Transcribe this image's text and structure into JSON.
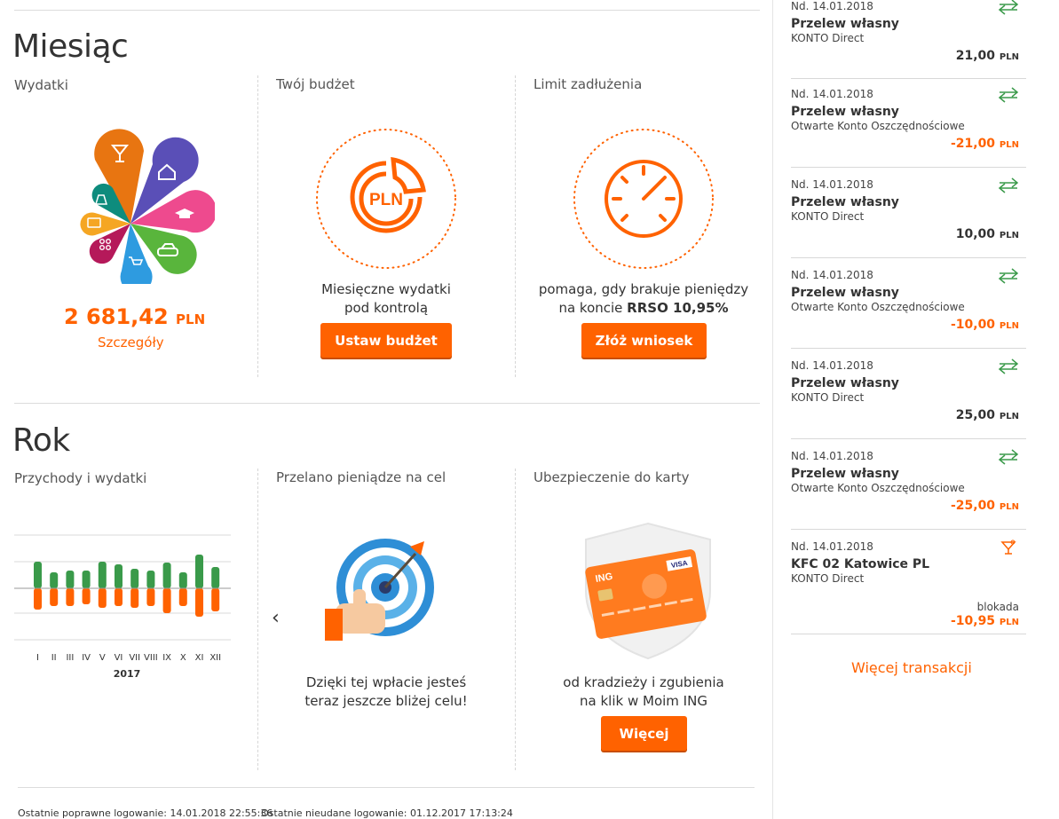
{
  "month": {
    "title": "Miesiąc",
    "expenses": {
      "label": "Wydatki",
      "amount": "2 681,42",
      "currency": "PLN",
      "link": "Szczegóły"
    },
    "budget": {
      "label": "Twój budżet",
      "icon_text": "PLN",
      "text_line1": "Miesięczne wydatki",
      "text_line2": "pod kontrolą",
      "button": "Ustaw budżet"
    },
    "debt": {
      "label": "Limit zadłużenia",
      "text_line1": "pomaga, gdy brakuje pieniędzy",
      "text_line2_prefix": "na koncie ",
      "text_line2_bold": "RRSO 10,95%",
      "button": "Złóż wniosek"
    }
  },
  "year": {
    "title": "Rok",
    "chart_label": "Przychody i wydatki",
    "goal": {
      "label": "Przelano pieniądze na cel",
      "text_line1": "Dzięki tej wpłacie jesteś",
      "text_line2": "teraz jeszcze bliżej celu!"
    },
    "insurance": {
      "label": "Ubezpieczenie do karty",
      "card_brand": "ING",
      "card_network": "VISA",
      "text_line1": "od kradzieży i zgubienia",
      "text_line2": "na klik w Moim ING",
      "button": "Więcej"
    }
  },
  "chart_data": {
    "type": "bar",
    "categories": [
      "I",
      "II",
      "III",
      "IV",
      "V",
      "VI",
      "VII",
      "VIII",
      "IX",
      "X",
      "XI",
      "XII"
    ],
    "year_label": "2017",
    "series": [
      {
        "values": [
          30,
          18,
          20,
          20,
          30,
          27,
          22,
          20,
          29,
          18,
          38,
          24
        ],
        "color": "#3a9a4a"
      },
      {
        "values": [
          -24,
          -20,
          -20,
          -18,
          -22,
          -20,
          -22,
          -20,
          -28,
          -20,
          -32,
          -26
        ],
        "color": "#ff6200"
      }
    ]
  },
  "transactions": [
    {
      "date": "Nd. 14.01.2018",
      "title": "Przelew własny",
      "account": "KONTO Direct",
      "amount": "21,00",
      "currency": "PLN",
      "negative": false,
      "icon": "transfer-icon"
    },
    {
      "date": "Nd. 14.01.2018",
      "title": "Przelew własny",
      "account": "Otwarte Konto Oszczędnościowe",
      "amount": "-21,00",
      "currency": "PLN",
      "negative": true,
      "icon": "transfer-icon"
    },
    {
      "date": "Nd. 14.01.2018",
      "title": "Przelew własny",
      "account": "KONTO Direct",
      "amount": "10,00",
      "currency": "PLN",
      "negative": false,
      "icon": "transfer-icon"
    },
    {
      "date": "Nd. 14.01.2018",
      "title": "Przelew własny",
      "account": "Otwarte Konto Oszczędnościowe",
      "amount": "-10,00",
      "currency": "PLN",
      "negative": true,
      "icon": "transfer-icon"
    },
    {
      "date": "Nd. 14.01.2018",
      "title": "Przelew własny",
      "account": "KONTO Direct",
      "amount": "25,00",
      "currency": "PLN",
      "negative": false,
      "icon": "transfer-icon"
    },
    {
      "date": "Nd. 14.01.2018",
      "title": "Przelew własny",
      "account": "Otwarte Konto Oszczędnościowe",
      "amount": "-25,00",
      "currency": "PLN",
      "negative": true,
      "icon": "transfer-icon"
    },
    {
      "date": "Nd. 14.01.2018",
      "title": "KFC 02 Katowice PL",
      "account": "KONTO Direct",
      "note": "blokada",
      "amount": "-10,95",
      "currency": "PLN",
      "negative": true,
      "icon": "cocktail-icon"
    }
  ],
  "more_transactions": "Więcej transakcji",
  "footer": {
    "last_login_ok": "Ostatnie poprawne logowanie: 14.01.2018 22:55:36",
    "last_login_fail": "Ostatnie nieudane logowanie: 01.12.2017 17:13:24"
  },
  "colors": {
    "accent": "#ff6200",
    "income": "#3a9a4a"
  }
}
